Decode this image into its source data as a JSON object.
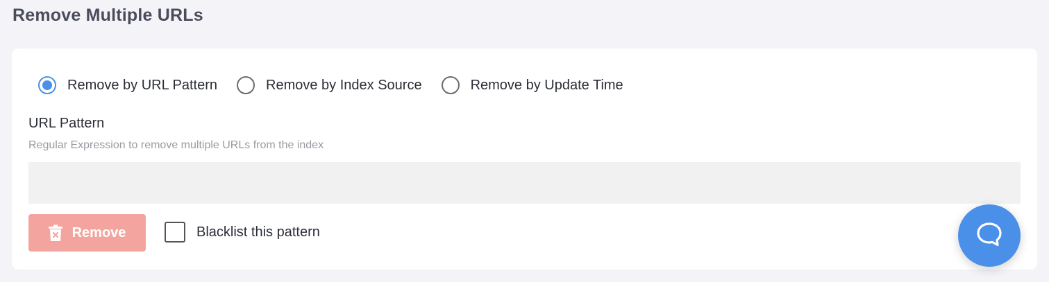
{
  "page": {
    "title": "Remove Multiple URLs"
  },
  "remove_mode": {
    "options": [
      {
        "label": "Remove by URL Pattern",
        "selected": true
      },
      {
        "label": "Remove by Index Source",
        "selected": false
      },
      {
        "label": "Remove by Update Time",
        "selected": false
      }
    ]
  },
  "url_pattern": {
    "label": "URL Pattern",
    "help": "Regular Expression to remove multiple URLs from the index",
    "value": "",
    "placeholder": ""
  },
  "actions": {
    "remove_label": "Remove",
    "remove_icon": "trash-icon",
    "blacklist_label": "Blacklist this pattern",
    "blacklist_checked": false
  },
  "chat": {
    "icon": "chat-bubble-icon"
  },
  "colors": {
    "accent": "#4a90e8",
    "remove_button": "#f4a49f",
    "input_background": "#f1f1f1",
    "page_background": "#f4f4f8"
  }
}
